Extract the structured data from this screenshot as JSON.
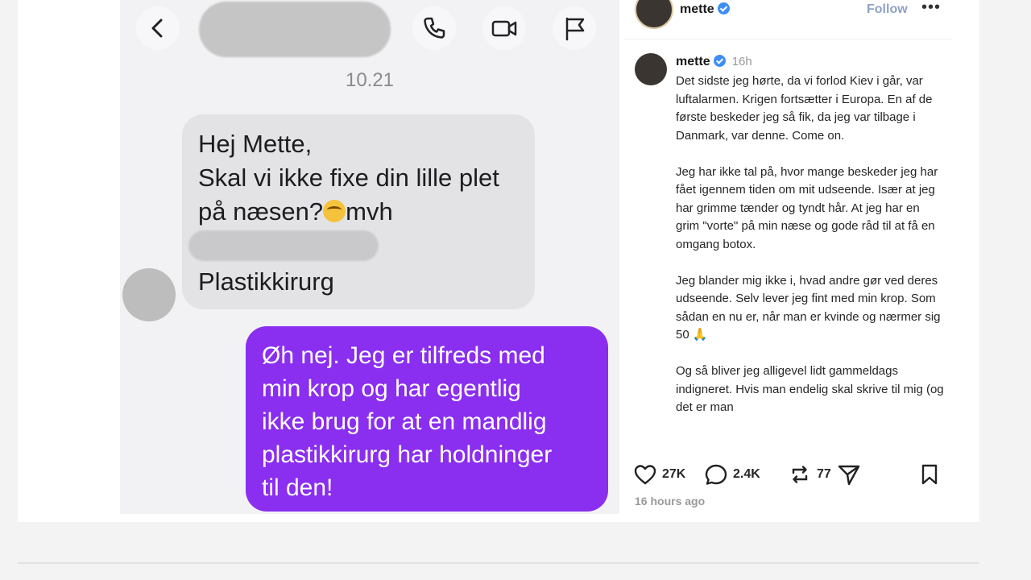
{
  "chat": {
    "timestamp": "10.21",
    "incoming_lines": [
      "Hej Mette,",
      "Skal vi ikke fixe din lille plet",
      "på næsen?",
      "mvh"
    ],
    "signature": "Plastikkirurg",
    "outgoing_lines": [
      "Øh nej. Jeg er tilfreds med",
      "min krop og har egentlig",
      "ikke brug for at en mandlig",
      "plastikkirurg har holdninger",
      "til den!"
    ],
    "icons": [
      "back-chevron-icon",
      "phone-icon",
      "video-icon",
      "flag-icon"
    ]
  },
  "post": {
    "username": "mette",
    "follow_label": "Follow",
    "more_label": "•••",
    "time_ago": "16h",
    "paragraphs": [
      "Det sidste jeg hørte, da vi forlod Kiev i går, var luftalarmen. Krigen fortsætter i Europa. En af de første beskeder jeg så fik, da jeg var tilbage i Danmark, var denne. Come on.",
      "Jeg har ikke tal på, hvor mange beskeder jeg har fået igennem tiden om mit udseende. Især at jeg har grimme tænder og tyndt hår. At jeg har en grim \"vorte\" på min næse og gode råd til at få en omgang botox.",
      "Jeg blander mig ikke i, hvad andre gør ved deres udseende. Selv lever jeg fint med min krop. Som sådan en nu er, når man er kvinde og nærmer sig 50 🙏",
      "Og så bliver jeg alligevel lidt gammeldags indigneret. Hvis man endelig skal skrive til mig (og det er man"
    ],
    "likes": "27K",
    "comments": "2.4K",
    "reposts": "77",
    "posted": "16 hours ago"
  },
  "colors": {
    "outgoing_bubble": "#8a2ef0",
    "incoming_bubble": "#e3e3e6",
    "verified": "#3d8ef7"
  }
}
